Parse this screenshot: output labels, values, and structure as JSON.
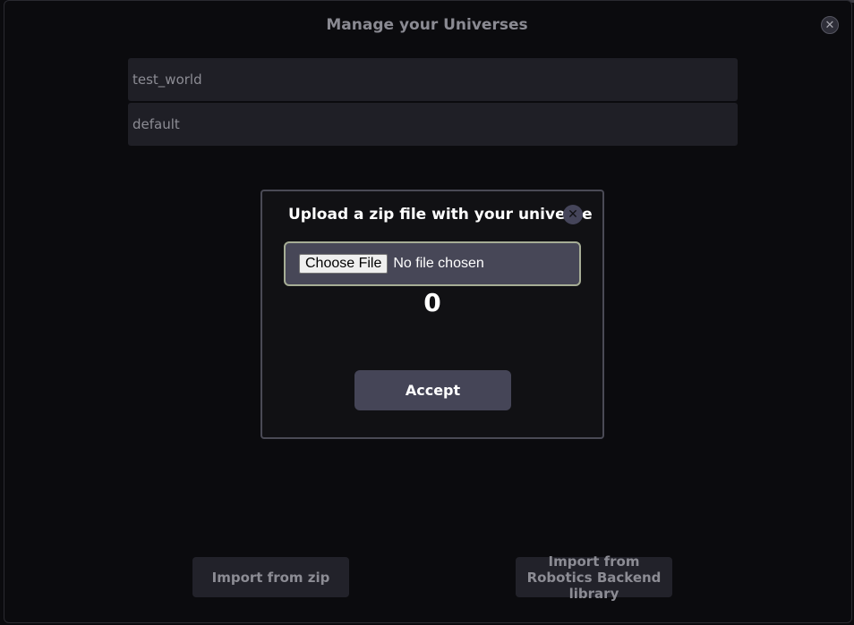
{
  "manager": {
    "title": "Manage your Universes",
    "close_icon": "close-icon",
    "universes": [
      "test_world",
      "default"
    ],
    "buttons": {
      "import_zip": "Import from zip",
      "import_robotics": "Import from Robotics Backend library"
    }
  },
  "upload_dialog": {
    "title": "Upload a zip file with your universe",
    "close_icon": "close-icon",
    "file_input": {
      "button_label": "Choose File",
      "status": "No file chosen"
    },
    "counter": "0",
    "accept_label": "Accept"
  },
  "colors": {
    "background": "#0b0b0e",
    "dialog_background": "#111114",
    "file_box": "#474757",
    "file_box_border": "#a6ad95",
    "accept_button": "#454557",
    "list_item": "#1f1f26"
  }
}
